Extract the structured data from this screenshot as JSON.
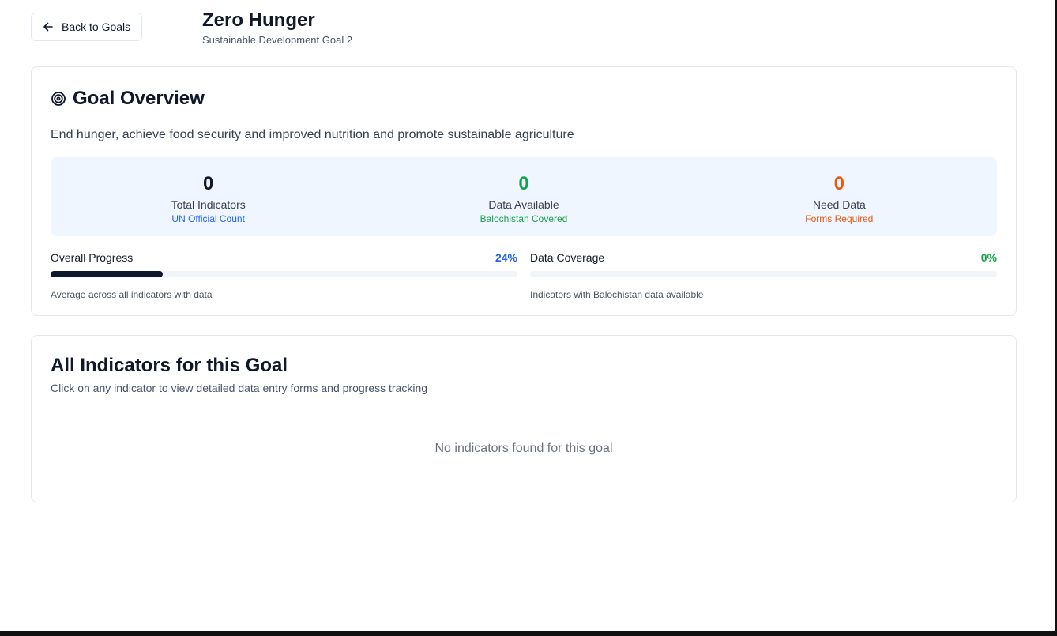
{
  "header": {
    "back_label": "Back to Goals",
    "title": "Zero Hunger",
    "subtitle": "Sustainable Development Goal 2"
  },
  "overview": {
    "title": "Goal Overview",
    "description": "End hunger, achieve food security and improved nutrition and promote sustainable agriculture",
    "stats": [
      {
        "value": "0",
        "label": "Total Indicators",
        "sub": "UN Official Count",
        "value_color": "#0f172a",
        "sub_color": "#2563eb"
      },
      {
        "value": "0",
        "label": "Data Available",
        "sub": "Balochistan Covered",
        "value_color": "#16a34a",
        "sub_color": "#16a34a"
      },
      {
        "value": "0",
        "label": "Need Data",
        "sub": "Forms Required",
        "value_color": "#ea580c",
        "sub_color": "#ea580c"
      }
    ],
    "overall_progress": {
      "label": "Overall Progress",
      "percent_text": "24%",
      "fraction": 0.24,
      "note": "Average across all indicators with data",
      "color": "#2563eb"
    },
    "data_coverage": {
      "label": "Data Coverage",
      "percent_text": "0%",
      "fraction": 0,
      "note": "Indicators with Balochistan data available",
      "color": "#16a34a"
    }
  },
  "indicators": {
    "title": "All Indicators for this Goal",
    "subtitle": "Click on any indicator to view detailed data entry forms and progress tracking",
    "empty_message": "No indicators found for this goal"
  }
}
